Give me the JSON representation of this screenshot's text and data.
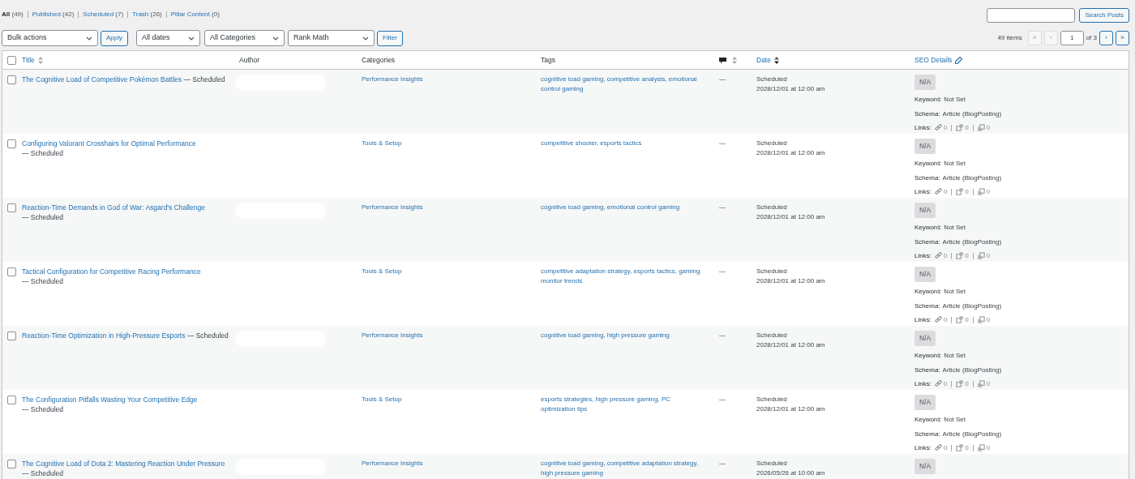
{
  "views": [
    {
      "label": "All",
      "count": "(49)",
      "selected": true
    },
    {
      "label": "Published",
      "count": "(42)",
      "selected": false
    },
    {
      "label": "Scheduled",
      "count": "(7)",
      "selected": false
    },
    {
      "label": "Trash",
      "count": "(26)",
      "selected": false
    },
    {
      "label": "Pillar Content",
      "count": "(0)",
      "selected": false
    }
  ],
  "search": {
    "button": "Search Posts"
  },
  "filters": {
    "bulk_actions": "Bulk actions",
    "apply": "Apply",
    "dates": "All dates",
    "categories": "All Categories",
    "rank_math": "Rank Math",
    "filter": "Filter"
  },
  "pagination": {
    "items": "49 items",
    "first": {
      "label": "«",
      "disabled": true
    },
    "prev": {
      "label": "‹",
      "disabled": true
    },
    "page": "1",
    "of": "of 3",
    "next": {
      "label": "›",
      "disabled": false
    },
    "last": {
      "label": "»",
      "disabled": false
    }
  },
  "select_all_checked": false,
  "columns": {
    "title": "Title",
    "author": "Author",
    "categories": "Categories",
    "tags": "Tags",
    "date": "Date",
    "seo": "SEO Details"
  },
  "rows": [
    {
      "title": "The Cognitive Load of Competitive Pokémon Battles",
      "status": "— Scheduled",
      "checked": false,
      "author_redacted": true,
      "category": "Performance Insights",
      "tags": "cognitive load gaming, competitive analysis, emotional control gaming",
      "comments": "—",
      "date_status": "Scheduled",
      "date": "2028/12/01 at 12:00 am",
      "score": "N/A",
      "keyword_label": "Keyword:",
      "keyword": "Not Set",
      "schema_label": "Schema:",
      "schema": "Article (BlogPosting)",
      "links_label": "Links:",
      "internal": "0",
      "external": "0",
      "incoming": "0"
    },
    {
      "title": "Configuring Valorant Crosshairs for Optimal Performance",
      "status": "— Scheduled",
      "checked": false,
      "author_redacted": false,
      "category": "Tools & Setup",
      "tags": "competitive shooter, esports tactics",
      "comments": "—",
      "date_status": "Scheduled",
      "date": "2028/12/01 at 12:00 am",
      "score": "N/A",
      "keyword_label": "Keyword:",
      "keyword": "Not Set",
      "schema_label": "Schema:",
      "schema": "Article (BlogPosting)",
      "links_label": "Links:",
      "internal": "0",
      "external": "0",
      "incoming": "0"
    },
    {
      "title": "Reaction-Time Demands in God of War: Asgard's Challenge",
      "status": "— Scheduled",
      "checked": false,
      "author_redacted": true,
      "category": "Performance Insights",
      "tags": "cognitive load gaming, emotional control gaming",
      "comments": "—",
      "date_status": "Scheduled",
      "date": "2028/12/01 at 12:00 am",
      "score": "N/A",
      "keyword_label": "Keyword:",
      "keyword": "Not Set",
      "schema_label": "Schema:",
      "schema": "Article (BlogPosting)",
      "links_label": "Links:",
      "internal": "0",
      "external": "0",
      "incoming": "0"
    },
    {
      "title": "Tactical Configuration for Competitive Racing Performance",
      "status": "— Scheduled",
      "checked": false,
      "author_redacted": false,
      "category": "Tools & Setup",
      "tags": "competitive adaptation strategy, esports tactics, gaming monitor trends",
      "comments": "—",
      "date_status": "Scheduled",
      "date": "2028/12/01 at 12:00 am",
      "score": "N/A",
      "keyword_label": "Keyword:",
      "keyword": "Not Set",
      "schema_label": "Schema:",
      "schema": "Article (BlogPosting)",
      "links_label": "Links:",
      "internal": "0",
      "external": "0",
      "incoming": "0"
    },
    {
      "title": "Reaction-Time Optimization in High-Pressure Esports",
      "status": "— Scheduled",
      "checked": false,
      "author_redacted": true,
      "category": "Performance Insights",
      "tags": "cognitive load gaming, high pressure gaming",
      "comments": "—",
      "date_status": "Scheduled",
      "date": "2028/12/01 at 12:00 am",
      "score": "N/A",
      "keyword_label": "Keyword:",
      "keyword": "Not Set",
      "schema_label": "Schema:",
      "schema": "Article (BlogPosting)",
      "links_label": "Links:",
      "internal": "0",
      "external": "0",
      "incoming": "0"
    },
    {
      "title": "The Configuration Pitfalls Wasting Your Competitive Edge",
      "status": "— Scheduled",
      "checked": false,
      "author_redacted": false,
      "category": "Tools & Setup",
      "tags": "esports strategies, high pressure gaming, PC optimization tips",
      "comments": "—",
      "date_status": "Scheduled",
      "date": "2028/12/01 at 12:00 am",
      "score": "N/A",
      "keyword_label": "Keyword:",
      "keyword": "Not Set",
      "schema_label": "Schema:",
      "schema": "Article (BlogPosting)",
      "links_label": "Links:",
      "internal": "0",
      "external": "0",
      "incoming": "0"
    },
    {
      "title": "The Cognitive Load of Dota 2: Mastering Reaction Under Pressure",
      "status": "— Scheduled",
      "checked": false,
      "author_redacted": true,
      "category": "Performance Insights",
      "tags": "cognitive load gaming, competitive adaptation strategy, high pressure gaming",
      "comments": "—",
      "date_status": "Scheduled",
      "date": "2026/05/26 at 10:00 am",
      "score": "N/A"
    }
  ]
}
